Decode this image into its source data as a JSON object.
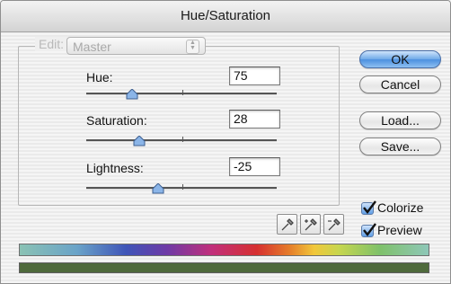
{
  "window": {
    "title": "Hue/Saturation"
  },
  "edit": {
    "label": "Edit:",
    "value": "Master"
  },
  "hue": {
    "label": "Hue:",
    "value": "75",
    "slider_fraction": 0.24
  },
  "saturation": {
    "label": "Saturation:",
    "value": "28",
    "slider_fraction": 0.28
  },
  "lightness": {
    "label": "Lightness:",
    "value": "-25",
    "slider_fraction": 0.375
  },
  "buttons": {
    "ok": "OK",
    "cancel": "Cancel",
    "load": "Load...",
    "save": "Save..."
  },
  "colorize": {
    "label": "Colorize",
    "checked": true
  },
  "preview": {
    "label": "Preview",
    "checked": true
  },
  "colors": {
    "default_button": "#6ea9e8",
    "result_bar": "#4f6a3c",
    "checkbox": "#5f9ee6"
  },
  "icons": [
    "eyedropper-icon",
    "eyedropper-plus-icon",
    "eyedropper-minus-icon"
  ]
}
